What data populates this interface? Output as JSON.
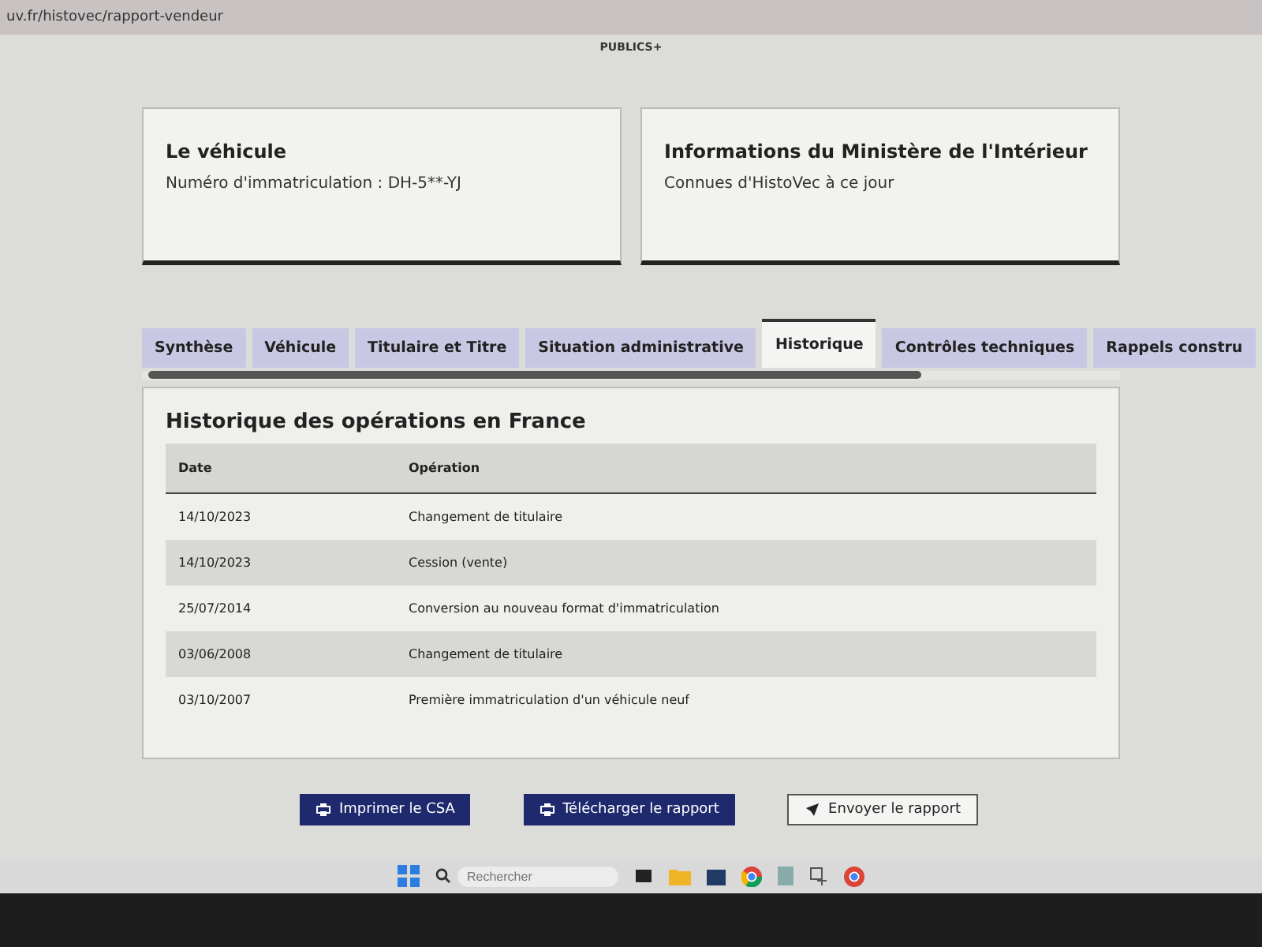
{
  "browser": {
    "url": "uv.fr/histovec/rapport-vendeur"
  },
  "logo": {
    "text": "PUBLICS+"
  },
  "cards": [
    {
      "title": "Le véhicule",
      "text": "Numéro d'immatriculation : DH-5**-YJ"
    },
    {
      "title": "Informations du Ministère de l'Intérieur",
      "text": "Connues d'HistoVec à ce jour"
    }
  ],
  "tabs": [
    {
      "label": "Synthèse",
      "selected": false
    },
    {
      "label": "Véhicule",
      "selected": false
    },
    {
      "label": "Titulaire et Titre",
      "selected": false
    },
    {
      "label": "Situation administrative",
      "selected": false
    },
    {
      "label": "Historique",
      "selected": true
    },
    {
      "label": "Contrôles techniques",
      "selected": false
    },
    {
      "label": "Rappels constru",
      "selected": false
    }
  ],
  "section": {
    "title": "Historique des opérations en France"
  },
  "table": {
    "columns": [
      "Date",
      "Opération"
    ],
    "rows": [
      [
        "14/10/2023",
        "Changement de titulaire"
      ],
      [
        "14/10/2023",
        "Cession (vente)"
      ],
      [
        "25/07/2014",
        "Conversion au nouveau format d'immatriculation"
      ],
      [
        "03/06/2008",
        "Changement de titulaire"
      ],
      [
        "03/10/2007",
        "Première immatriculation d'un véhicule neuf"
      ]
    ]
  },
  "buttons": [
    {
      "label": "Imprimer le CSA",
      "kind": "print"
    },
    {
      "label": "Télécharger le rapport",
      "kind": "print"
    },
    {
      "label": "Envoyer le rapport",
      "kind": "send"
    }
  ],
  "taskbar": {
    "search_placeholder": "Rechercher"
  }
}
